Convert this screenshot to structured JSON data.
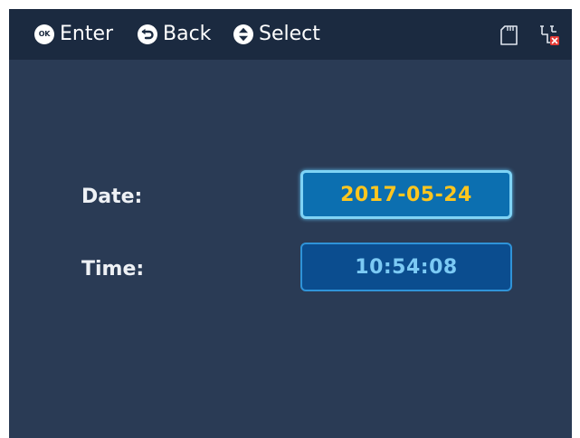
{
  "topbar": {
    "enter_label": "Enter",
    "back_label": "Back",
    "select_label": "Select",
    "enter_icon": "ok-icon",
    "enter_icon_text": "OK",
    "back_icon": "back-arrow-icon",
    "select_icon": "up-down-icon",
    "status_icons": [
      "sd-card-icon",
      "network-disconnected-icon"
    ]
  },
  "form": {
    "date_label": "Date:",
    "date_value": "2017-05-24",
    "time_label": "Time:",
    "time_value": "10:54:08",
    "selected_field": "date"
  },
  "colors": {
    "background": "#2a3b55",
    "topbar": "#1b2a40",
    "selected_value_text": "#ffc61e",
    "value_text": "#7ccaf4",
    "selected_box": "#0c6fb0",
    "box": "#0b4d8f",
    "error_mark": "#e53935"
  }
}
